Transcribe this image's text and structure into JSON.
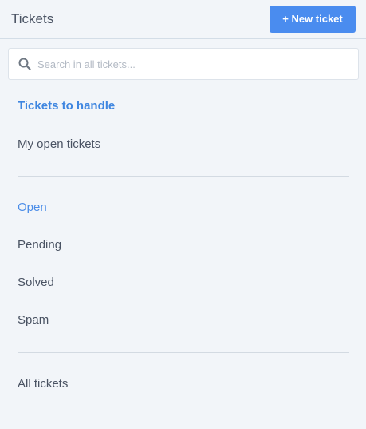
{
  "header": {
    "title": "Tickets",
    "new_ticket_label": "+ New ticket"
  },
  "search": {
    "placeholder": "Search in all tickets...",
    "value": "",
    "icon": "search-icon"
  },
  "nav": {
    "section_heading": "Tickets to handle",
    "my_open": "My open tickets",
    "statuses": {
      "open": "Open",
      "pending": "Pending",
      "solved": "Solved",
      "spam": "Spam"
    },
    "all_tickets": "All tickets"
  },
  "colors": {
    "accent": "#4a8cef",
    "heading": "#3f86e0",
    "text": "#4a5363",
    "background": "#f2f5f9",
    "divider": "#d3dae2"
  }
}
